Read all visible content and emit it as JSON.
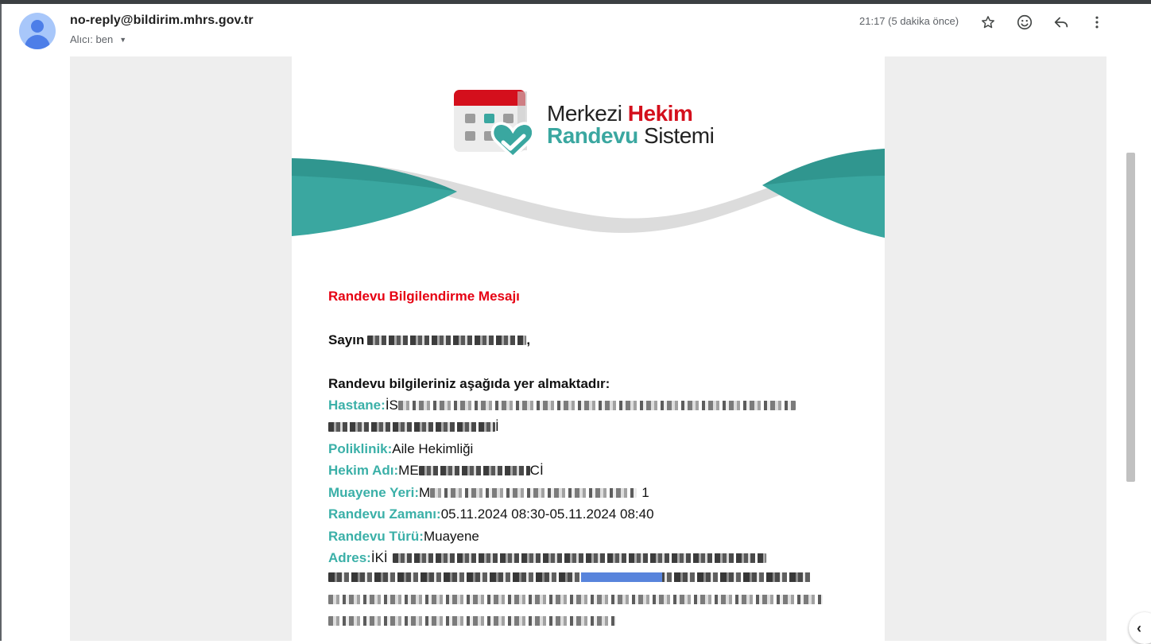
{
  "header": {
    "sender": "no-reply@bildirim.mhrs.gov.tr",
    "recipients_label": "Alıcı: ben",
    "timestamp": "21:17 (5 dakika önce)",
    "icons": [
      "star-icon",
      "emoji-icon",
      "reply-icon",
      "more-vert-icon"
    ]
  },
  "logo": {
    "line1_a": "Merkezi ",
    "line1_b": "Hekim",
    "line2_a": "Randevu",
    "line2_b": " Sistemi"
  },
  "message": {
    "title": "Randevu Bilgilendirme Mesajı",
    "greeting": "Sayın",
    "greeting_end": ",",
    "intro": "Randevu bilgileriniz aşağıda yer almaktadır:"
  },
  "fields": {
    "hastane": {
      "label": "Hastane:",
      "value_prefix": "İS"
    },
    "hastane_line2_suffix": "İ",
    "poliklinik": {
      "label": "Poliklinik:",
      "value": "Aile Hekimliği"
    },
    "hekim": {
      "label": "Hekim Adı:",
      "value_prefix": "ME",
      "value_suffix": "Cİ"
    },
    "muayene_yeri": {
      "label": "Muayene Yeri:",
      "value_prefix": "M",
      "value_suffix": "1"
    },
    "zaman": {
      "label": "Randevu Zamanı:",
      "value": "05.11.2024 08:30-05.11.2024 08:40"
    },
    "tur": {
      "label": "Randevu Türü:",
      "value": "Muayene"
    },
    "adres": {
      "label": "Adres:",
      "value_prefix": "İKİ"
    }
  },
  "colors": {
    "title_red": "#e60012",
    "label_teal": "#3bb0a8",
    "brand_red": "#d40f1c",
    "brand_teal": "#3aa7a0"
  }
}
